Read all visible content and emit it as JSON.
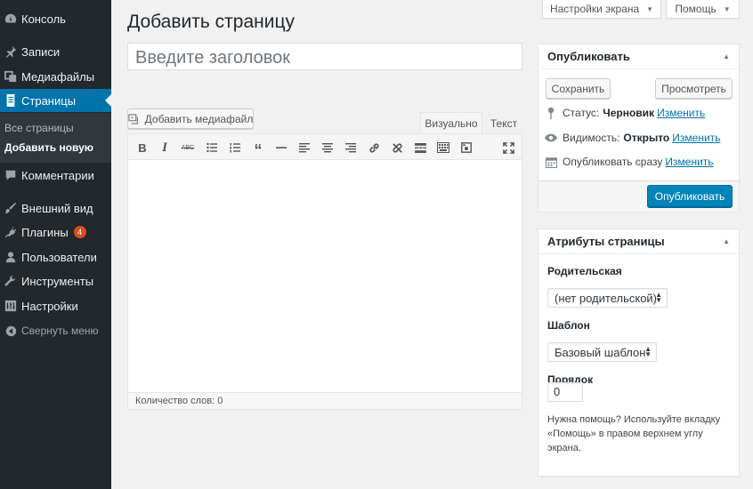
{
  "sidebar": {
    "items": [
      {
        "name": "menu-console",
        "icon": "dashboard-icon",
        "label": "Консоль"
      },
      {
        "name": "menu-posts",
        "icon": "pin-icon",
        "label": "Записи"
      },
      {
        "name": "menu-media",
        "icon": "media-icon",
        "label": "Медиафайлы"
      },
      {
        "name": "menu-pages",
        "icon": "page-icon",
        "label": "Страницы"
      },
      {
        "name": "menu-comments",
        "icon": "comment-icon",
        "label": "Комментарии"
      },
      {
        "name": "menu-appearance",
        "icon": "brush-icon",
        "label": "Внешний вид"
      },
      {
        "name": "menu-plugins",
        "icon": "plugin-icon",
        "label": "Плагины",
        "badge": "4"
      },
      {
        "name": "menu-users",
        "icon": "user-icon",
        "label": "Пользователи"
      },
      {
        "name": "menu-tools",
        "icon": "wrench-icon",
        "label": "Инструменты"
      },
      {
        "name": "menu-settings",
        "icon": "settings-icon",
        "label": "Настройки"
      }
    ],
    "submenu": [
      "Все страницы",
      "Добавить новую"
    ],
    "collapse_label": "Свернуть меню"
  },
  "top": {
    "screen_options": "Настройки экрана",
    "help": "Помощь"
  },
  "page_title": "Добавить страницу",
  "title_placeholder": "Введите заголовок",
  "editor": {
    "add_media": "Добавить медиафайл",
    "tab_visual": "Визуально",
    "tab_text": "Текст",
    "word_count": "Количество слов: 0",
    "toolbar": [
      "bold-icon",
      "italic-icon",
      "strikethrough-icon",
      "bullet-list-icon",
      "numbered-list-icon",
      "blockquote-icon",
      "horizontal-rule-icon",
      "align-left-icon",
      "align-center-icon",
      "align-right-icon",
      "link-icon",
      "unlink-icon",
      "read-more-icon",
      "toolbar-toggle-icon",
      "insert-media-icon",
      "fullscreen-icon"
    ]
  },
  "publish": {
    "title": "Опубликовать",
    "save": "Сохранить",
    "preview": "Просмотреть",
    "status_label": "Статус:",
    "status_value": "Черновик",
    "visibility_label": "Видимость:",
    "visibility_value": "Открыто",
    "schedule_label": "Опубликовать сразу",
    "edit": "Изменить",
    "publish_button": "Опубликовать"
  },
  "attributes": {
    "title": "Атрибуты страницы",
    "parent_label": "Родительская",
    "parent_value": "(нет родительской)",
    "template_label": "Шаблон",
    "template_value": "Базовый шаблон",
    "order_label": "Порядок",
    "order_value": "0",
    "help_text": "Нужна помощь? Используйте вкладку «Помощь» в правом верхнем углу экрана."
  },
  "colors": {
    "sidebar_bg": "#23282d",
    "accent": "#0073aa",
    "primary_button": "#0085ba",
    "badge": "#d54e21"
  }
}
